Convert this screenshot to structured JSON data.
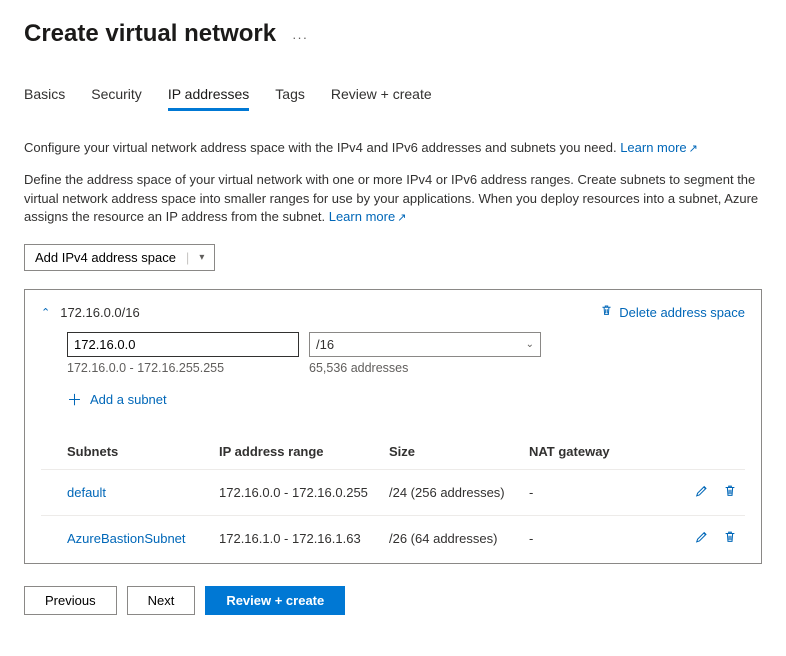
{
  "title": "Create virtual network",
  "ellipsis": "···",
  "tabs": [
    "Basics",
    "Security",
    "IP addresses",
    "Tags",
    "Review + create"
  ],
  "activeTab": "IP addresses",
  "intro1": "Configure your virtual network address space with the IPv4 and IPv6 addresses and subnets you need. ",
  "intro1_link": "Learn more",
  "intro2": "Define the address space of your virtual network with one or more IPv4 or IPv6 address ranges. Create subnets to segment the virtual network address space into smaller ranges for use by your applications. When you deploy resources into a subnet, Azure assigns the resource an IP address from the subnet. ",
  "intro2_link": "Learn more",
  "addSpaceLabel": "Add IPv4 address space",
  "space": {
    "header": "172.16.0.0/16",
    "deleteLabel": "Delete address space",
    "ipValue": "172.16.0.0",
    "cidr": "/16",
    "rangeText": "172.16.0.0 - 172.16.255.255",
    "countText": "65,536 addresses",
    "addSubnetLabel": "Add a subnet"
  },
  "columns": {
    "c1": "Subnets",
    "c2": "IP address range",
    "c3": "Size",
    "c4": "NAT gateway"
  },
  "rows": [
    {
      "name": "default",
      "range": "172.16.0.0 - 172.16.0.255",
      "size": "/24 (256 addresses)",
      "nat": "-"
    },
    {
      "name": "AzureBastionSubnet",
      "range": "172.16.1.0 - 172.16.1.63",
      "size": "/26 (64 addresses)",
      "nat": "-"
    }
  ],
  "footer": {
    "prev": "Previous",
    "next": "Next",
    "review": "Review + create"
  }
}
